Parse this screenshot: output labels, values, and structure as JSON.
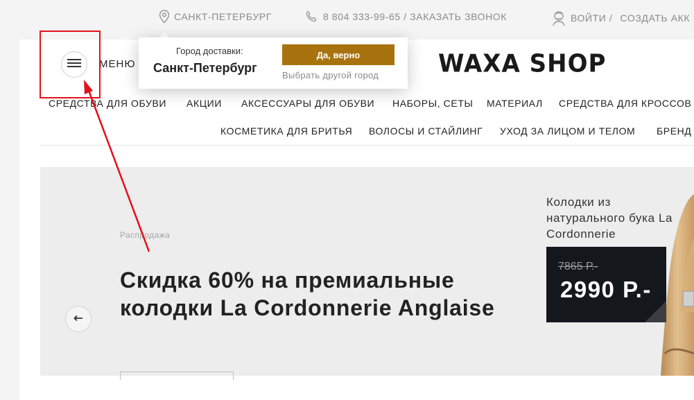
{
  "topbar": {
    "city": "САНКТ-ПЕТЕРБУРГ",
    "phone": "8 804 333-99-65 / ЗАКАЗАТЬ ЗВОНОК",
    "login": "ВОЙТИ /",
    "register": "СОЗДАТЬ АКК"
  },
  "header": {
    "menu_label": "МЕНЮ",
    "logo": "WAXA SHOP"
  },
  "city_popup": {
    "label": "Город доставки:",
    "city": "Санкт-Петербург",
    "confirm": "Да, верно",
    "other": "Выбрать другой город"
  },
  "nav": {
    "row1": [
      "СРЕДСТВА ДЛЯ ОБУВИ",
      "АКЦИИ",
      "АКСЕССУАРЫ ДЛЯ ОБУВИ",
      "НАБОРЫ, СЕТЫ",
      "МАТЕРИАЛ",
      "СРЕДСТВА ДЛЯ КРОССОВ"
    ],
    "row2": [
      "КОСМЕТИКА ДЛЯ БРИТЬЯ",
      "ВОЛОСЫ И СТАЙЛИНГ",
      "УХОД ЗА ЛИЦОМ И ТЕЛОМ",
      "БРЕНД"
    ]
  },
  "hero": {
    "tag": "Распродажа",
    "title": "Скидка 60% на премиальные колодки La Cordonnerie Anglaise"
  },
  "product": {
    "title": "Колодки из натурального бука La Cordonnerie",
    "old_price": "7865 Р.-",
    "new_price": "2990 Р.-"
  },
  "icons": {
    "location": "location-pin-icon",
    "phone": "phone-icon",
    "user": "user-avatar-icon",
    "menu": "hamburger-icon",
    "prev": "arrow-left-icon"
  },
  "colors": {
    "accent": "#a8730f",
    "highlight": "#e3101b",
    "price_bg": "#14171c"
  }
}
